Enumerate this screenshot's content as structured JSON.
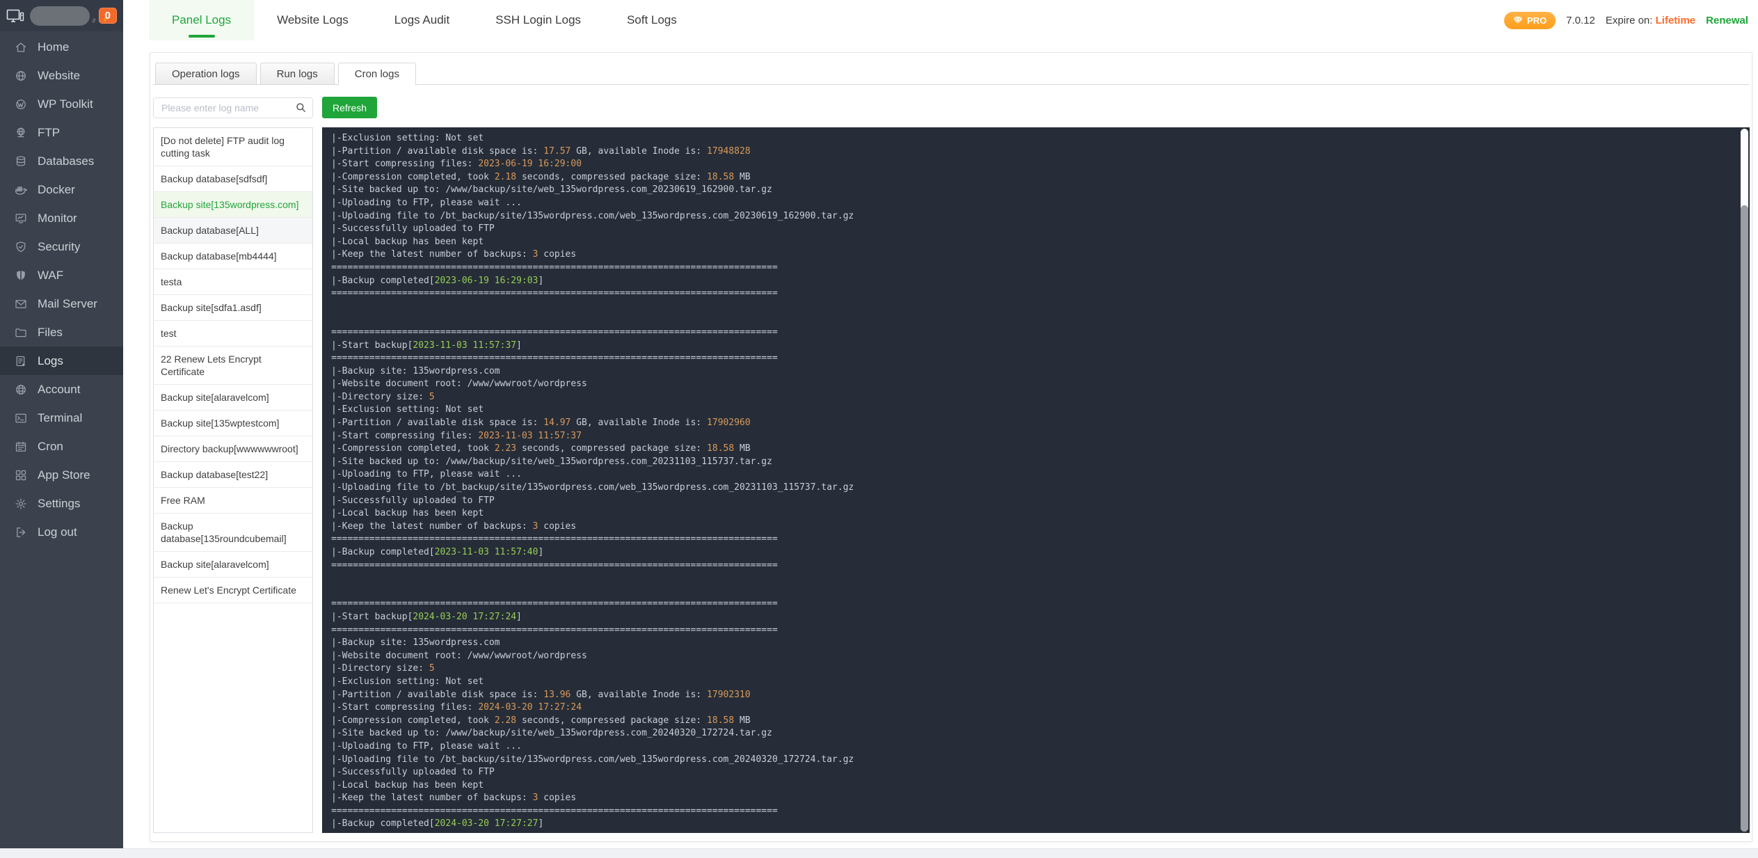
{
  "header": {
    "badge_count": "0",
    "tabs": [
      {
        "label": "Panel Logs",
        "active": true
      },
      {
        "label": "Website Logs",
        "active": false
      },
      {
        "label": "Logs Audit",
        "active": false
      },
      {
        "label": "SSH Login Logs",
        "active": false
      },
      {
        "label": "Soft Logs",
        "active": false
      }
    ],
    "meta": {
      "pro_label": "PRO",
      "version": "7.0.12",
      "expire_label": "Expire on:",
      "expire_value": "Lifetime",
      "renewal_label": "Renewal"
    }
  },
  "sidebar": {
    "items": [
      {
        "label": "Home",
        "icon": "home-icon",
        "active": false
      },
      {
        "label": "Website",
        "icon": "globe-icon",
        "active": false
      },
      {
        "label": "WP Toolkit",
        "icon": "wordpress-icon",
        "active": false
      },
      {
        "label": "FTP",
        "icon": "ftp-globe-icon",
        "active": false
      },
      {
        "label": "Databases",
        "icon": "database-icon",
        "active": false
      },
      {
        "label": "Docker",
        "icon": "docker-icon",
        "active": false
      },
      {
        "label": "Monitor",
        "icon": "monitor-chart-icon",
        "active": false
      },
      {
        "label": "Security",
        "icon": "shield-check-icon",
        "active": false
      },
      {
        "label": "WAF",
        "icon": "shield-filled-icon",
        "active": false
      },
      {
        "label": "Mail Server",
        "icon": "envelope-icon",
        "active": false
      },
      {
        "label": "Files",
        "icon": "folder-icon",
        "active": false
      },
      {
        "label": "Logs",
        "icon": "log-file-icon",
        "active": true
      },
      {
        "label": "Account",
        "icon": "account-globe-icon",
        "active": false
      },
      {
        "label": "Terminal",
        "icon": "terminal-icon",
        "active": false
      },
      {
        "label": "Cron",
        "icon": "calendar-icon",
        "active": false
      },
      {
        "label": "App Store",
        "icon": "app-grid-icon",
        "active": false
      },
      {
        "label": "Settings",
        "icon": "gear-icon",
        "active": false
      },
      {
        "label": "Log out",
        "icon": "logout-icon",
        "active": false
      }
    ]
  },
  "content": {
    "subtabs": [
      {
        "label": "Operation logs",
        "active": false
      },
      {
        "label": "Run logs",
        "active": false
      },
      {
        "label": "Cron logs",
        "active": true
      }
    ],
    "search_placeholder": "Please enter log name",
    "refresh_label": "Refresh",
    "log_list": [
      {
        "label": "[Do not delete] FTP audit log cutting task",
        "state": "normal"
      },
      {
        "label": "Backup database[sdfsdf]",
        "state": "normal"
      },
      {
        "label": "Backup site[135wordpress.com]",
        "state": "selected"
      },
      {
        "label": "Backup database[ALL]",
        "state": "highlight"
      },
      {
        "label": "Backup database[mb4444]",
        "state": "normal"
      },
      {
        "label": "testa",
        "state": "normal"
      },
      {
        "label": "Backup site[sdfa1.asdf]",
        "state": "normal"
      },
      {
        "label": "test",
        "state": "normal"
      },
      {
        "label": "22 Renew Lets Encrypt Certificate",
        "state": "normal"
      },
      {
        "label": "Backup site[alaravelcom]",
        "state": "normal"
      },
      {
        "label": "Backup site[135wptestcom]",
        "state": "normal"
      },
      {
        "label": "Directory backup[wwwwwwroot]",
        "state": "normal"
      },
      {
        "label": "Backup database[test22]",
        "state": "normal"
      },
      {
        "label": "Free RAM",
        "state": "normal"
      },
      {
        "label": "Backup database[135roundcubemail]",
        "state": "normal"
      },
      {
        "label": "Backup site[alaravelcom]",
        "state": "normal"
      },
      {
        "label": "Renew Let's Encrypt Certificate",
        "state": "normal"
      }
    ],
    "terminal": {
      "separator": "==================================================================================",
      "lines": [
        [
          [
            "d",
            "|-Exclusion setting: Not set"
          ]
        ],
        [
          [
            "d",
            "|-Partition / available disk space is: "
          ],
          [
            "o",
            "17.57"
          ],
          [
            "d",
            " GB, available Inode is: "
          ],
          [
            "o",
            "17948828"
          ]
        ],
        [
          [
            "d",
            "|-Start compressing files: "
          ],
          [
            "o",
            "2023-06-19 16:29:00"
          ]
        ],
        [
          [
            "d",
            "|-Compression completed, took "
          ],
          [
            "o",
            "2.18"
          ],
          [
            "d",
            " seconds, compressed package size: "
          ],
          [
            "o",
            "18.58"
          ],
          [
            "d",
            " MB"
          ]
        ],
        [
          [
            "d",
            "|-Site backed up to: /www/backup/site/web_135wordpress.com_20230619_162900.tar.gz"
          ]
        ],
        [
          [
            "d",
            "|-Uploading to FTP, please wait ..."
          ]
        ],
        [
          [
            "d",
            "|-Uploading file to /bt_backup/site/135wordpress.com/web_135wordpress.com_20230619_162900.tar.gz"
          ]
        ],
        [
          [
            "d",
            "|-Successfully uploaded to FTP"
          ]
        ],
        [
          [
            "d",
            "|-Local backup has been kept"
          ]
        ],
        [
          [
            "d",
            "|-Keep the latest number of backups: "
          ],
          [
            "o",
            "3"
          ],
          [
            "d",
            " copies"
          ]
        ],
        "sep",
        [
          [
            "d",
            "|-Backup completed["
          ],
          [
            "g",
            "2023-06-19 16:29:03"
          ],
          [
            "d",
            "]"
          ]
        ],
        "sep",
        "blank",
        "blank",
        "sep",
        [
          [
            "d",
            "|-Start backup["
          ],
          [
            "g",
            "2023-11-03 11:57:37"
          ],
          [
            "d",
            "]"
          ]
        ],
        "sep",
        [
          [
            "d",
            "|-Backup site: 135wordpress.com"
          ]
        ],
        [
          [
            "d",
            "|-Website document root: /www/wwwroot/wordpress"
          ]
        ],
        [
          [
            "d",
            "|-Directory size: "
          ],
          [
            "o",
            "5"
          ]
        ],
        [
          [
            "d",
            "|-Exclusion setting: Not set"
          ]
        ],
        [
          [
            "d",
            "|-Partition / available disk space is: "
          ],
          [
            "o",
            "14.97"
          ],
          [
            "d",
            " GB, available Inode is: "
          ],
          [
            "o",
            "17902960"
          ]
        ],
        [
          [
            "d",
            "|-Start compressing files: "
          ],
          [
            "o",
            "2023-11-03 11:57:37"
          ]
        ],
        [
          [
            "d",
            "|-Compression completed, took "
          ],
          [
            "o",
            "2.23"
          ],
          [
            "d",
            " seconds, compressed package size: "
          ],
          [
            "o",
            "18.58"
          ],
          [
            "d",
            " MB"
          ]
        ],
        [
          [
            "d",
            "|-Site backed up to: /www/backup/site/web_135wordpress.com_20231103_115737.tar.gz"
          ]
        ],
        [
          [
            "d",
            "|-Uploading to FTP, please wait ..."
          ]
        ],
        [
          [
            "d",
            "|-Uploading file to /bt_backup/site/135wordpress.com/web_135wordpress.com_20231103_115737.tar.gz"
          ]
        ],
        [
          [
            "d",
            "|-Successfully uploaded to FTP"
          ]
        ],
        [
          [
            "d",
            "|-Local backup has been kept"
          ]
        ],
        [
          [
            "d",
            "|-Keep the latest number of backups: "
          ],
          [
            "o",
            "3"
          ],
          [
            "d",
            " copies"
          ]
        ],
        "sep",
        [
          [
            "d",
            "|-Backup completed["
          ],
          [
            "g",
            "2023-11-03 11:57:40"
          ],
          [
            "d",
            "]"
          ]
        ],
        "sep",
        "blank",
        "blank",
        "sep",
        [
          [
            "d",
            "|-Start backup["
          ],
          [
            "g",
            "2024-03-20 17:27:24"
          ],
          [
            "d",
            "]"
          ]
        ],
        "sep",
        [
          [
            "d",
            "|-Backup site: 135wordpress.com"
          ]
        ],
        [
          [
            "d",
            "|-Website document root: /www/wwwroot/wordpress"
          ]
        ],
        [
          [
            "d",
            "|-Directory size: "
          ],
          [
            "o",
            "5"
          ]
        ],
        [
          [
            "d",
            "|-Exclusion setting: Not set"
          ]
        ],
        [
          [
            "d",
            "|-Partition / available disk space is: "
          ],
          [
            "o",
            "13.96"
          ],
          [
            "d",
            " GB, available Inode is: "
          ],
          [
            "o",
            "17902310"
          ]
        ],
        [
          [
            "d",
            "|-Start compressing files: "
          ],
          [
            "o",
            "2024-03-20 17:27:24"
          ]
        ],
        [
          [
            "d",
            "|-Compression completed, took "
          ],
          [
            "o",
            "2.28"
          ],
          [
            "d",
            " seconds, compressed package size: "
          ],
          [
            "o",
            "18.58"
          ],
          [
            "d",
            " MB"
          ]
        ],
        [
          [
            "d",
            "|-Site backed up to: /www/backup/site/web_135wordpress.com_20240320_172724.tar.gz"
          ]
        ],
        [
          [
            "d",
            "|-Uploading to FTP, please wait ..."
          ]
        ],
        [
          [
            "d",
            "|-Uploading file to /bt_backup/site/135wordpress.com/web_135wordpress.com_20240320_172724.tar.gz"
          ]
        ],
        [
          [
            "d",
            "|-Successfully uploaded to FTP"
          ]
        ],
        [
          [
            "d",
            "|-Local backup has been kept"
          ]
        ],
        [
          [
            "d",
            "|-Keep the latest number of backups: "
          ],
          [
            "o",
            "3"
          ],
          [
            "d",
            " copies"
          ]
        ],
        "sep",
        [
          [
            "d",
            "|-Backup completed["
          ],
          [
            "g",
            "2024-03-20 17:27:27"
          ],
          [
            "d",
            "]"
          ]
        ],
        "sep"
      ]
    }
  },
  "colors": {
    "accent_green": "#20a53a",
    "sidebar_bg": "#3b424d",
    "sidebar_header_bg": "#343b46",
    "terminal_bg": "#262d38",
    "terminal_text": "#c9cfd8",
    "terminal_orange": "#d9995a",
    "terminal_green": "#96cd54",
    "pro_badge_orange": "#ff9e1b",
    "count_badge_orange": "#f3692a",
    "lifetime_orange": "#ff6a2b"
  }
}
